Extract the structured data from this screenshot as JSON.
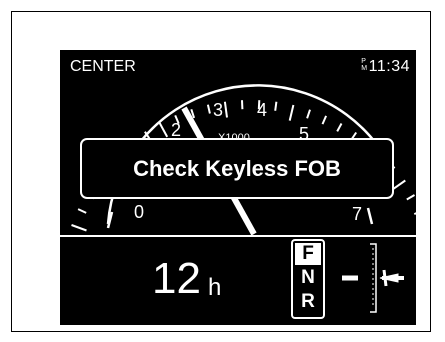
{
  "display": {
    "mode": "CENTER",
    "clock": {
      "ampm_top": "P",
      "ampm_bottom": "M",
      "time": "11:34"
    },
    "tachometer": {
      "scale_labels": [
        "0",
        "2",
        "3",
        "4",
        "5",
        "7"
      ],
      "multiplier": "X1000"
    },
    "warning": {
      "message": "Check Keyless FOB"
    },
    "engine_hours": {
      "value": "12",
      "unit": "h"
    },
    "gear": {
      "forward": "F",
      "neutral": "N",
      "reverse": "R",
      "selected": "F"
    }
  },
  "colors": {
    "background": "#000000",
    "foreground": "#ffffff"
  }
}
